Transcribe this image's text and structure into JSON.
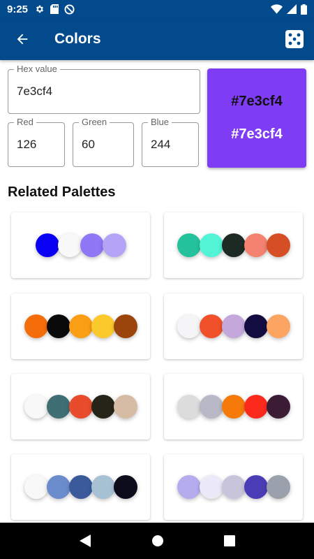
{
  "status_bar": {
    "time": "9:25"
  },
  "app_bar": {
    "title": "Colors"
  },
  "inputs": {
    "hex": {
      "label": "Hex value",
      "value": "7e3cf4"
    },
    "red": {
      "label": "Red",
      "value": "126"
    },
    "green": {
      "label": "Green",
      "value": "60"
    },
    "blue": {
      "label": "Blue",
      "value": "244"
    }
  },
  "preview": {
    "color": "#7e3cf4",
    "dark_text": "#7e3cf4",
    "light_text": "#7e3cf4"
  },
  "section": {
    "title": "Related Palettes"
  },
  "palettes": [
    [
      "#0a00f5",
      "#f8f8f8",
      "#8e78f6",
      "#b3a4f8"
    ],
    [
      "#24c29c",
      "#52f4d5",
      "#1c2a23",
      "#f38370",
      "#d64e24"
    ],
    [
      "#f56c0a",
      "#0a0a0a",
      "#fa9e16",
      "#fcc92c",
      "#9b440c"
    ],
    [
      "#f5f5f8",
      "#f0502a",
      "#c4a8dc",
      "#130c40",
      "#fca462"
    ],
    [
      "#f8f8f8",
      "#3f6e73",
      "#e84c2c",
      "#262418",
      "#d6bca4"
    ],
    [
      "#dcdcdc",
      "#b8b8c6",
      "#f57a0a",
      "#fc2a1c",
      "#3a1c34"
    ],
    [
      "#f8f8f8",
      "#6b8ccc",
      "#3a5a9c",
      "#a6c0d4",
      "#0c0c1c"
    ],
    [
      "#b4acec",
      "#eceaf8",
      "#c8c4dc",
      "#4a3cb4",
      "#9aa0ac"
    ]
  ]
}
